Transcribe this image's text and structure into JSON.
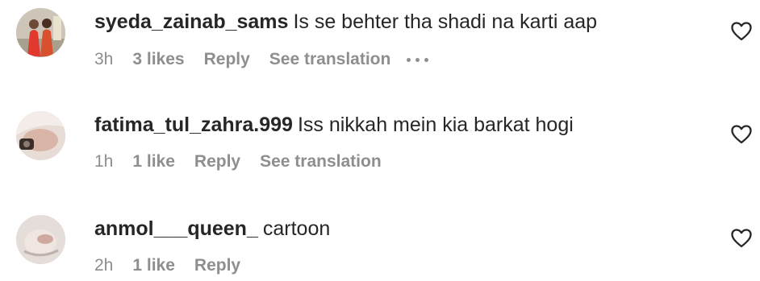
{
  "comments": [
    {
      "username": "syeda_zainab_sams",
      "text": "Is se behter tha shadi na karti aap",
      "time": "3h",
      "likes": "3 likes",
      "reply": "Reply",
      "translation": "See translation",
      "has_more": true
    },
    {
      "username": "fatima_tul_zahra.999",
      "text": "Iss nikkah mein kia barkat hogi",
      "time": "1h",
      "likes": "1 like",
      "reply": "Reply",
      "translation": "See translation",
      "has_more": false
    },
    {
      "username": "anmol___queen_",
      "text": "cartoon",
      "time": "2h",
      "likes": "1 like",
      "reply": "Reply",
      "translation": "",
      "has_more": false
    }
  ],
  "icons": {
    "like": "heart-icon",
    "more": "more-options-icon"
  },
  "colors": {
    "text": "#262626",
    "secondary": "#8e8e8e",
    "background": "#ffffff"
  }
}
